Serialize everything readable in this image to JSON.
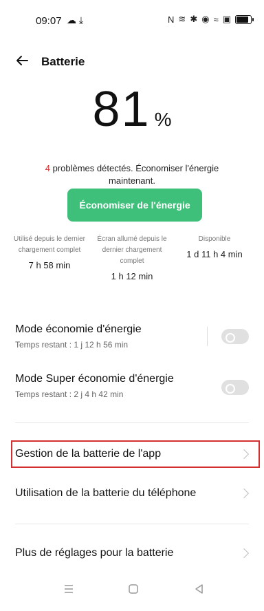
{
  "status_bar": {
    "time": "09:07",
    "left_icons": [
      "messenger-icon",
      "download-icon"
    ],
    "right_icons": [
      "nfc-icon",
      "vibrate-icon",
      "bluetooth-icon",
      "location-icon",
      "wifi-icon",
      "sim-icon",
      "battery-icon"
    ]
  },
  "header": {
    "title": "Batterie"
  },
  "battery": {
    "value": "81",
    "symbol": "%"
  },
  "alert": {
    "count": "4",
    "text": " problèmes détectés. Économiser l'énergie maintenant."
  },
  "save_button": {
    "label": "Économiser de l'énergie",
    "color": "#3ec07a"
  },
  "stats": [
    {
      "label": "Utilisé depuis le dernier chargement complet",
      "value": "7 h 58 min"
    },
    {
      "label": "Écran allumé depuis le dernier chargement complet",
      "value": "1 h 12 min"
    },
    {
      "label": "Disponible",
      "value": "1 d 11 h 4 min"
    }
  ],
  "modes": [
    {
      "title": "Mode économie d'énergie",
      "subtitle": "Temps restant : 1 j 12 h 56 min"
    },
    {
      "title": "Mode Super économie d'énergie",
      "subtitle": "Temps restant : 2 j 4 h 42 min"
    }
  ],
  "list": [
    {
      "label": "Gestion de la batterie de l'app"
    },
    {
      "label": "Utilisation de la batterie du téléphone"
    },
    {
      "label": "Plus de réglages pour la batterie"
    }
  ],
  "nav": {
    "menu_icon": "menu-icon",
    "home_icon": "home-icon",
    "back_icon": "back-triangle-icon"
  }
}
